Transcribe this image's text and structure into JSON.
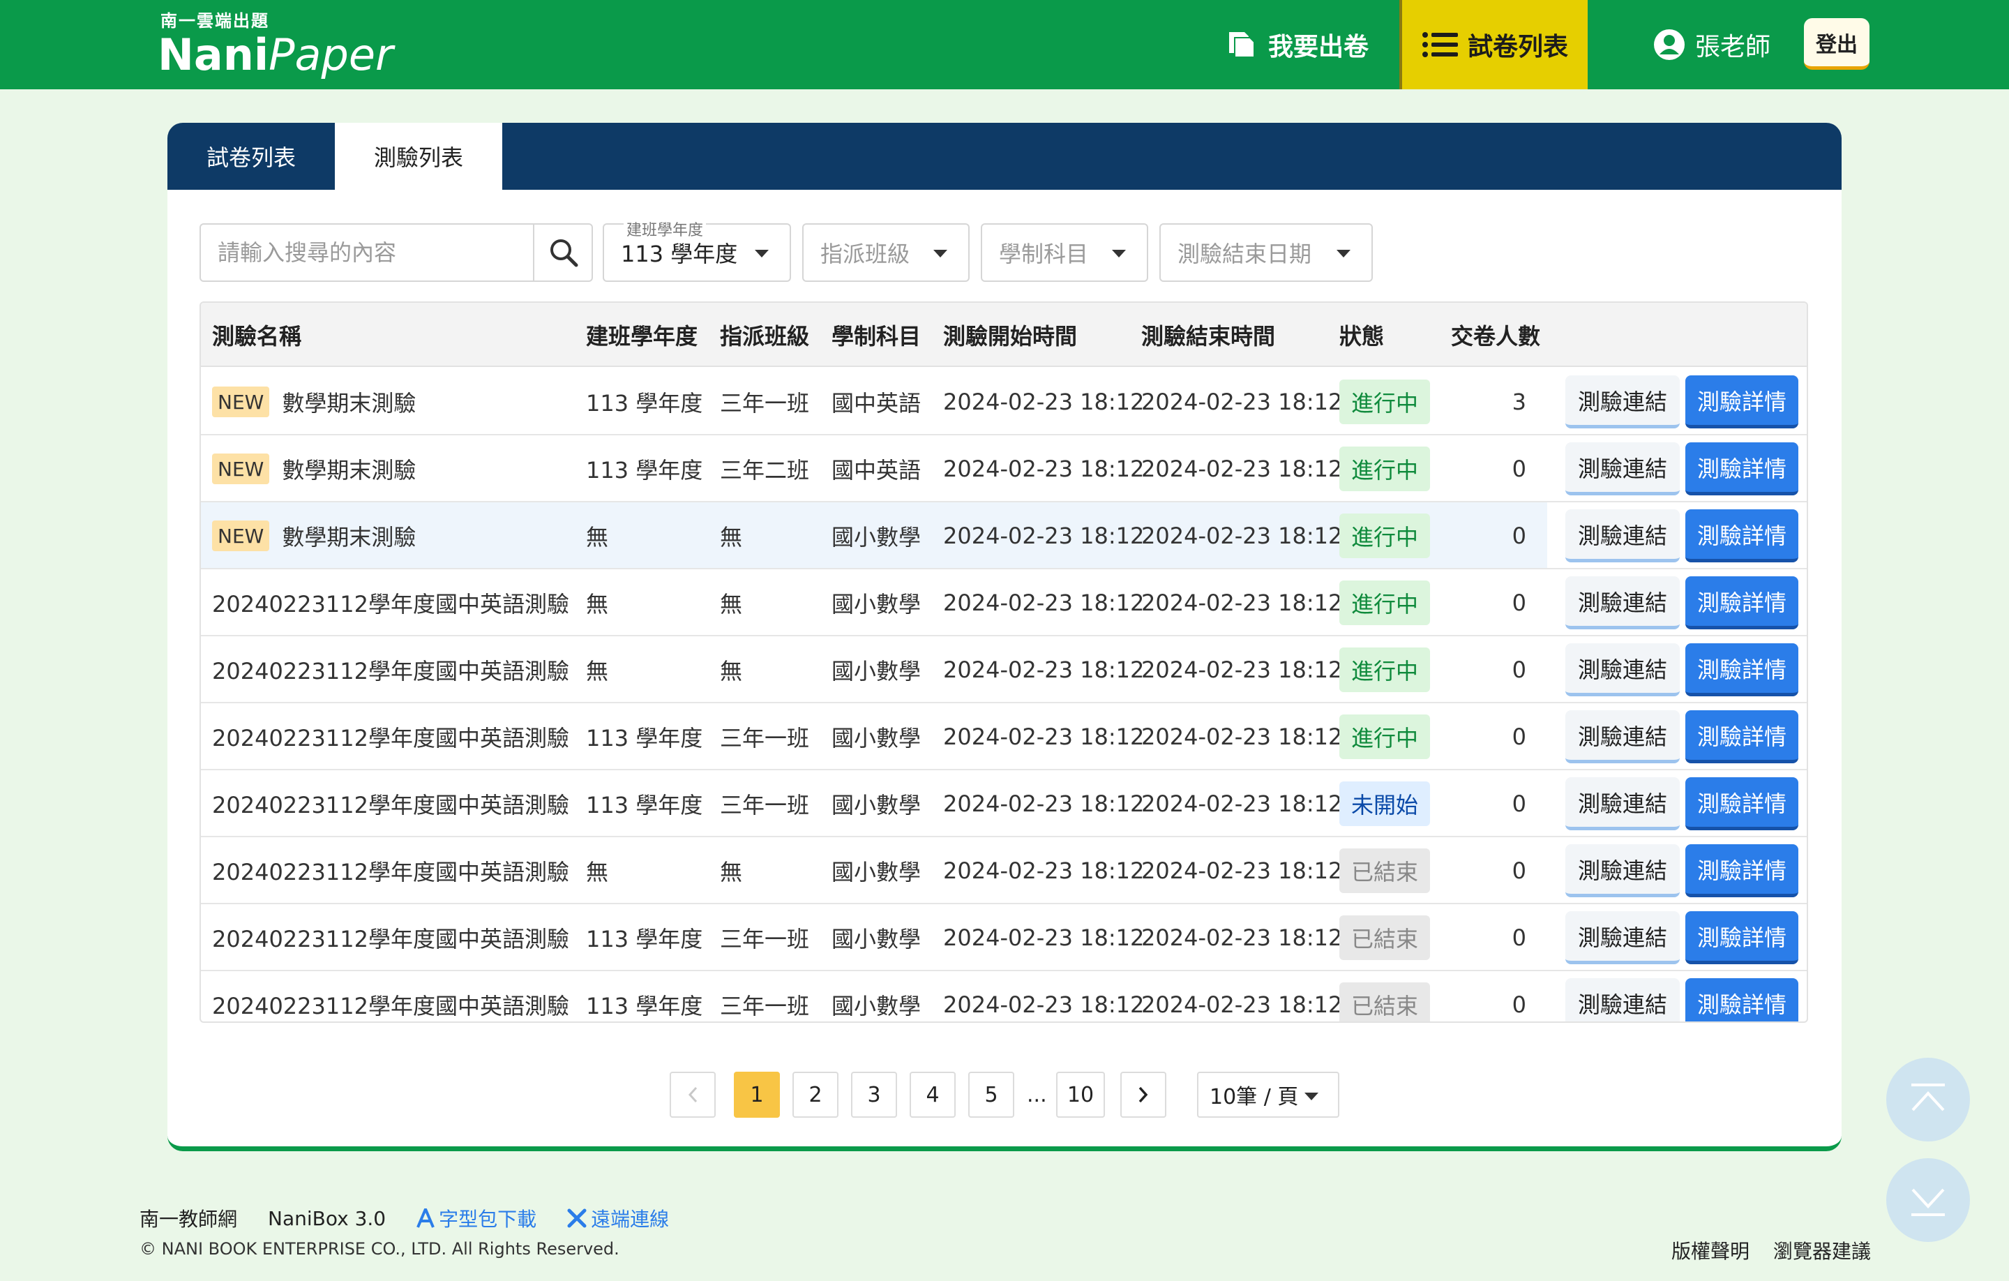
{
  "header": {
    "brand_small": "南一雲端出題",
    "brand_name": "Nani",
    "brand_name2": "Paper",
    "nav_make": "我要出卷",
    "nav_list": "試卷列表",
    "user": "張老師",
    "logout": "登出"
  },
  "tabs": [
    "試卷列表",
    "測驗列表"
  ],
  "filters": {
    "search_placeholder": "請輸入搜尋的內容",
    "year_label": "建班學年度",
    "year_value": "113 學年度",
    "class_placeholder": "指派班級",
    "subject_placeholder": "學制科目",
    "enddate_placeholder": "測驗結束日期"
  },
  "table": {
    "headers": [
      "測驗名稱",
      "建班學年度",
      "指派班級",
      "學制科目",
      "測驗開始時間",
      "測驗結束時間",
      "狀態",
      "交卷人數"
    ],
    "new_label": "NEW",
    "link_label": "測驗連結",
    "detail_label": "測驗詳情",
    "rows": [
      {
        "new": true,
        "name": "數學期末測驗",
        "year": "113 學年度",
        "cls": "三年一班",
        "subject": "國中英語",
        "start": "2024-02-23 18:12",
        "end": "2024-02-23 18:12",
        "status": "進行中",
        "count": "3"
      },
      {
        "new": true,
        "name": "數學期末測驗",
        "year": "113 學年度",
        "cls": "三年二班",
        "subject": "國中英語",
        "start": "2024-02-23 18:12",
        "end": "2024-02-23 18:12",
        "status": "進行中",
        "count": "0"
      },
      {
        "new": true,
        "name": "數學期末測驗",
        "year": "無",
        "cls": "無",
        "subject": "國小數學",
        "start": "2024-02-23 18:12",
        "end": "2024-02-23 18:12",
        "status": "進行中",
        "count": "0"
      },
      {
        "new": false,
        "name": "20240223112學年度國中英語測驗",
        "year": "無",
        "cls": "無",
        "subject": "國小數學",
        "start": "2024-02-23 18:12",
        "end": "2024-02-23 18:12",
        "status": "進行中",
        "count": "0"
      },
      {
        "new": false,
        "name": "20240223112學年度國中英語測驗",
        "year": "無",
        "cls": "無",
        "subject": "國小數學",
        "start": "2024-02-23 18:12",
        "end": "2024-02-23 18:12",
        "status": "進行中",
        "count": "0"
      },
      {
        "new": false,
        "name": "20240223112學年度國中英語測驗",
        "year": "113 學年度",
        "cls": "三年一班",
        "subject": "國小數學",
        "start": "2024-02-23 18:12",
        "end": "2024-02-23 18:12",
        "status": "進行中",
        "count": "0"
      },
      {
        "new": false,
        "name": "20240223112學年度國中英語測驗",
        "year": "113 學年度",
        "cls": "三年一班",
        "subject": "國小數學",
        "start": "2024-02-23 18:12",
        "end": "2024-02-23 18:12",
        "status": "未開始",
        "count": "0"
      },
      {
        "new": false,
        "name": "20240223112學年度國中英語測驗",
        "year": "無",
        "cls": "無",
        "subject": "國小數學",
        "start": "2024-02-23 18:12",
        "end": "2024-02-23 18:12",
        "status": "已結束",
        "count": "0"
      },
      {
        "new": false,
        "name": "20240223112學年度國中英語測驗",
        "year": "113 學年度",
        "cls": "三年一班",
        "subject": "國小數學",
        "start": "2024-02-23 18:12",
        "end": "2024-02-23 18:12",
        "status": "已結束",
        "count": "0"
      },
      {
        "new": false,
        "name": "20240223112學年度國中英語測驗",
        "year": "113 學年度",
        "cls": "三年一班",
        "subject": "國小數學",
        "start": "2024-02-23 18:12",
        "end": "2024-02-23 18:12",
        "status": "已結束",
        "count": "0"
      }
    ]
  },
  "pagination": {
    "pages": [
      "1",
      "2",
      "3",
      "4",
      "5"
    ],
    "ellipsis": "...",
    "last": "10",
    "active": "1",
    "page_size": "10筆 / 頁"
  },
  "footer": {
    "link1": "南一教師網",
    "link2": "NaniBox 3.0",
    "link3": "字型包下載",
    "link4": "遠端連線",
    "copyright": "© NANI BOOK ENTERPRISE CO., LTD. All Rights Reserved.",
    "right1": "版權聲明",
    "right2": "瀏覽器建議"
  },
  "colors": {
    "header_green": "#0a9a4a",
    "nav_active": "#e6cf00",
    "tab_navy": "#0e3a66",
    "primary_blue": "#2b7de9",
    "status_running": "#0f8a3c",
    "status_pending": "#0b4aa8",
    "status_ended": "#888888",
    "page_active": "#f8c545"
  },
  "icons": [
    "papers-icon",
    "list-icon",
    "user-circle-icon",
    "search-icon",
    "caret-down-icon",
    "chevron-left-icon",
    "chevron-right-icon",
    "scroll-top-icon",
    "scroll-bottom-icon",
    "font-icon",
    "tools-icon"
  ]
}
